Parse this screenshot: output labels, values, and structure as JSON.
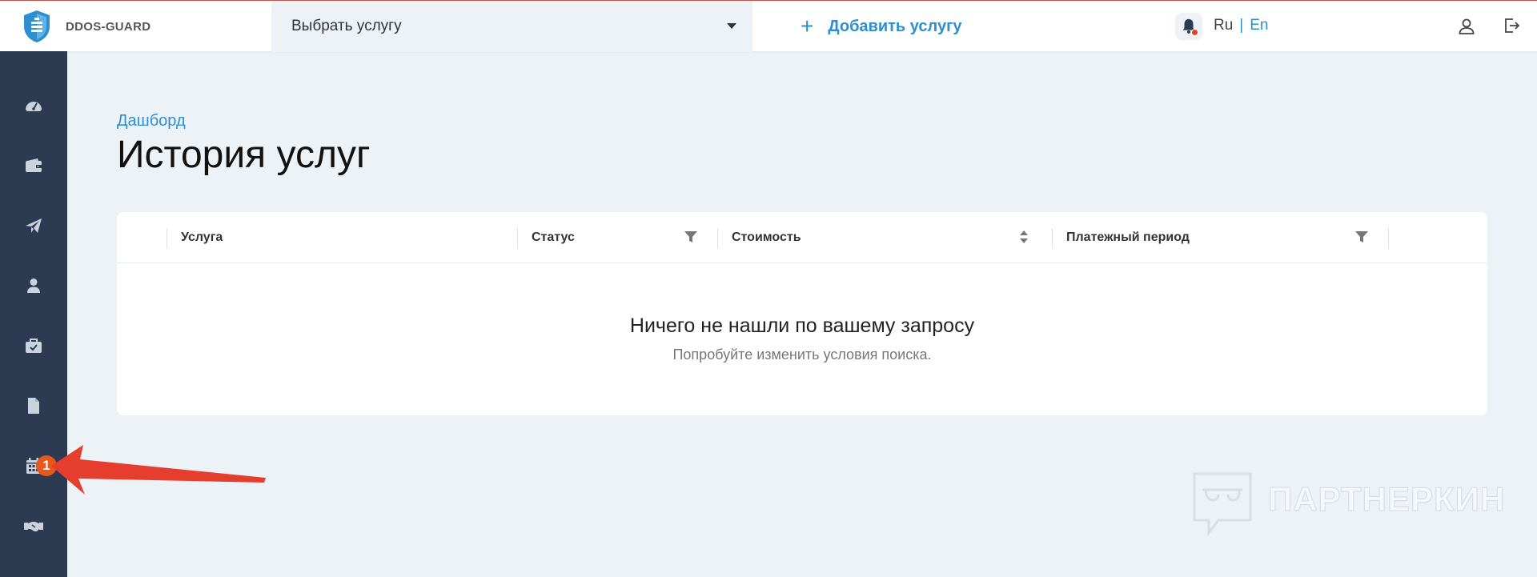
{
  "header": {
    "brand_name": "DDOS-GUARD",
    "service_select": {
      "value": "Выбрать услугу"
    },
    "add_service_label": "Добавить услугу",
    "lang": {
      "ru": "Ru",
      "separator": "|",
      "en": "En"
    }
  },
  "sidebar": {
    "items": [
      {
        "icon": "dashboard-icon"
      },
      {
        "icon": "wallet-icon"
      },
      {
        "icon": "paper-plane-icon"
      },
      {
        "icon": "user-icon"
      },
      {
        "icon": "briefcase-check-icon"
      },
      {
        "icon": "document-icon",
        "badge": "1"
      },
      {
        "icon": "calendar-icon"
      },
      {
        "icon": "handshake-icon"
      }
    ]
  },
  "main": {
    "breadcrumb": "Дашборд",
    "title": "История услуг",
    "table": {
      "columns": [
        "Услуга",
        "Статус",
        "Стоимость",
        "Платежный период"
      ],
      "empty_title": "Ничего не нашли по вашему запросу",
      "empty_subtitle": "Попробуйте изменить условия поиска."
    }
  },
  "watermark": "ПАРТНЕРКИН",
  "colors": {
    "accent": "#2d8fd1",
    "sidebar": "#2c3b52",
    "badge": "#e8571e",
    "annotation_arrow": "#e53e2e"
  }
}
